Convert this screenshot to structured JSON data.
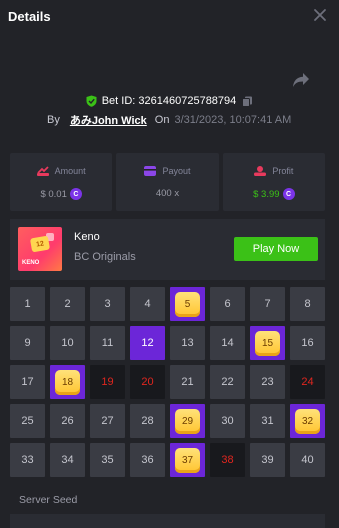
{
  "header": {
    "title": "Details"
  },
  "bet": {
    "id_label": "Bet ID: 3261460725788794",
    "by_label": "By",
    "user": "あみJohn Wick",
    "on_label": "On",
    "date": "3/31/2023, 10:07:41 AM"
  },
  "stats": {
    "amount": {
      "label": "Amount",
      "value": "$ 0.01"
    },
    "payout": {
      "label": "Payout",
      "value": "400 x"
    },
    "profit": {
      "label": "Profit",
      "value": "$ 3.99"
    }
  },
  "game": {
    "thumb_text": "KENO",
    "thumb_ball": "12",
    "name": "Keno",
    "provider": "BC Originals",
    "play_label": "Play Now"
  },
  "board": {
    "numbers": [
      "1",
      "2",
      "3",
      "4",
      "5",
      "6",
      "7",
      "8",
      "9",
      "10",
      "11",
      "12",
      "13",
      "14",
      "15",
      "16",
      "17",
      "18",
      "19",
      "20",
      "21",
      "22",
      "23",
      "24",
      "25",
      "26",
      "27",
      "28",
      "29",
      "30",
      "31",
      "32",
      "33",
      "34",
      "35",
      "36",
      "37",
      "38",
      "39",
      "40"
    ],
    "hits": [
      "5",
      "15",
      "18",
      "29",
      "32",
      "37"
    ],
    "picked": [
      "12"
    ],
    "misses": [
      "19",
      "20",
      "24",
      "38"
    ]
  },
  "server_seed": {
    "label": "Server Seed"
  },
  "colors": {
    "green": "#3bc117",
    "purple": "#6c26d8",
    "red": "#e0261f",
    "gold": "#ffc42e"
  }
}
